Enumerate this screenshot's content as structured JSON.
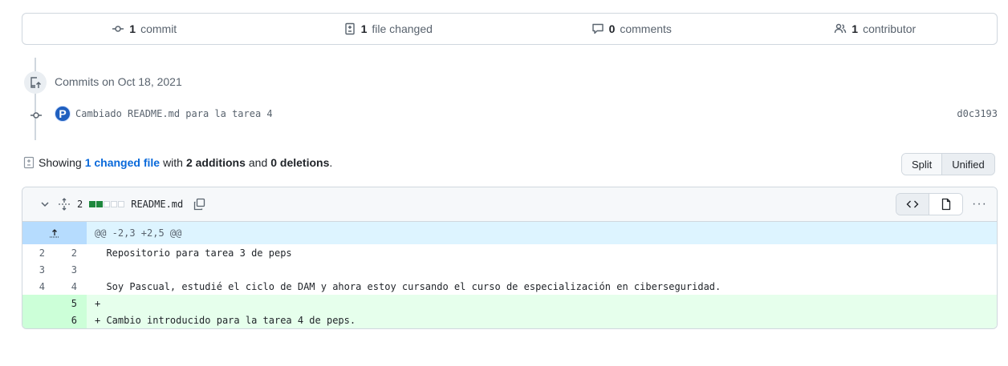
{
  "summary": {
    "commits": "1",
    "commits_label": "commit",
    "files": "1",
    "files_label": "file changed",
    "comments": "0",
    "comments_label": "comments",
    "contributors": "1",
    "contributors_label": "contributor"
  },
  "timeline": {
    "date": "Commits on Oct 18, 2021",
    "commit": {
      "avatar": "P",
      "message": "Cambiado README.md para la tarea 4",
      "sha": "d0c3193"
    }
  },
  "showing": {
    "prefix": "Showing",
    "link": "1 changed file",
    "with": "with",
    "additions": "2 additions",
    "and": "and",
    "deletions": "0 deletions",
    "end": "."
  },
  "view": {
    "split": "Split",
    "unified": "Unified"
  },
  "file": {
    "changes": "2",
    "name": "README.md",
    "hunk": "@@ -2,3 +2,5 @@",
    "lines": [
      {
        "old": "2",
        "new": "2",
        "text": "  Repositorio para tarea 3 de peps",
        "type": "ctx"
      },
      {
        "old": "3",
        "new": "3",
        "text": "",
        "type": "ctx"
      },
      {
        "old": "4",
        "new": "4",
        "text": "  Soy Pascual, estudié el ciclo de DAM y ahora estoy cursando el curso de especialización en ciberseguridad.",
        "type": "ctx"
      },
      {
        "old": "",
        "new": "5",
        "text": "+",
        "type": "add"
      },
      {
        "old": "",
        "new": "6",
        "text": "+ Cambio introducido para la tarea 4 de peps.",
        "type": "add"
      }
    ]
  },
  "more": "···"
}
